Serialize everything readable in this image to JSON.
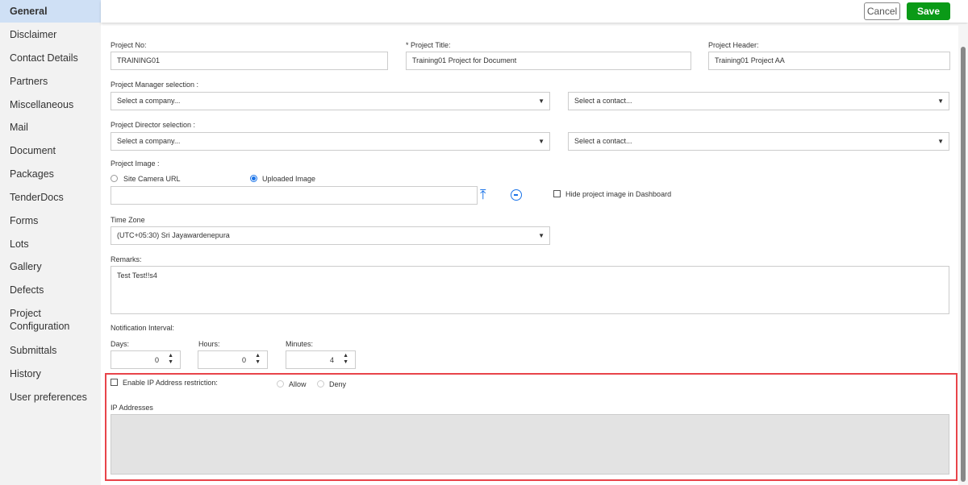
{
  "sidebar": {
    "items": [
      "General",
      "Disclaimer",
      "Contact Details",
      "Partners",
      "Miscellaneous",
      "Mail",
      "Document",
      "Packages",
      "TenderDocs",
      "Forms",
      "Lots",
      "Gallery",
      "Defects",
      "Project Configuration",
      "Submittals",
      "History",
      "User preferences"
    ]
  },
  "toolbar": {
    "cancel": "Cancel",
    "save": "Save"
  },
  "form": {
    "project_no_label": "Project No:",
    "project_no": "TRAINING01",
    "project_title_label": "* Project Title:",
    "project_title": "Training01 Project for Document",
    "project_header_label": "Project Header:",
    "project_header": "Training01 Project AA",
    "pm_label": "Project Manager selection :",
    "pd_label": "Project Director selection :",
    "company_placeholder": "Select a company...",
    "contact_placeholder": "Select a contact...",
    "image_label": "Project Image :",
    "site_camera": "Site Camera URL",
    "uploaded_image": "Uploaded Image",
    "hide_image": "Hide project image in Dashboard",
    "timezone_label": "Time Zone",
    "timezone": "(UTC+05:30) Sri Jayawardenepura",
    "remarks_label": "Remarks:",
    "remarks": "Test Test!!s4",
    "notif_label": "Notification Interval:",
    "days_label": "Days:",
    "days": "0",
    "hours_label": "Hours:",
    "hours": "0",
    "minutes_label": "Minutes:",
    "minutes": "4",
    "ip_enable": "Enable IP Address restriction:",
    "allow": "Allow",
    "deny": "Deny",
    "ip_label": "IP Addresses"
  }
}
